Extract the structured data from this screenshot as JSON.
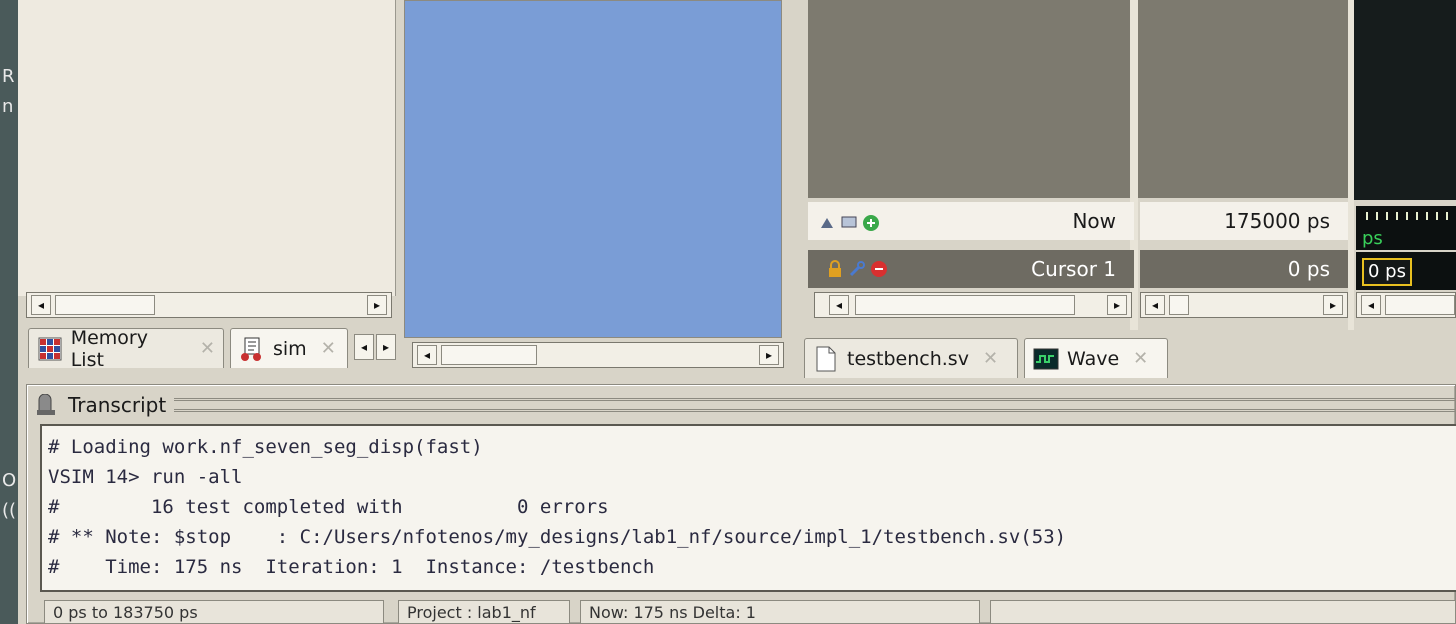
{
  "left_edge": {
    "chars": [
      "R",
      "n",
      "O",
      "(("
    ]
  },
  "tabs_left": [
    {
      "label": "Memory List",
      "close": "✕"
    },
    {
      "label": "sim",
      "close": "✕"
    }
  ],
  "tabs_right": [
    {
      "label": "testbench.sv",
      "close": "✕"
    },
    {
      "label": "Wave",
      "close": "✕"
    }
  ],
  "wave": {
    "now_label": "Now",
    "now_value": "175000 ps",
    "cursor_label": "Cursor 1",
    "cursor_value": "0 ps",
    "ruler_unit": "ps",
    "cursor_box": "0 ps"
  },
  "transcript": {
    "title": "Transcript",
    "lines": [
      "# Loading work.nf_seven_seg_disp(fast)",
      "VSIM 14> run -all",
      "#        16 test completed with          0 errors",
      "# ** Note: $stop    : C:/Users/nfotenos/my_designs/lab1_nf/source/impl_1/testbench.sv(53)",
      "#    Time: 175 ns  Iteration: 1  Instance: /testbench"
    ]
  },
  "statusbar": {
    "fields": [
      "0 ps to 183750 ps",
      "Project : lab1_nf",
      "Now: 175 ns  Delta: 1",
      ""
    ]
  },
  "icons": {
    "memory_list": "memory-grid-icon",
    "sim": "sim-hierarchy-icon",
    "testbench": "document-icon",
    "wave": "wave-window-icon",
    "transcript": "transcript-icon"
  },
  "colors": {
    "wave_bg": "#161c1c",
    "cursor_box_border": "#e8c020",
    "ruler_text": "#39d05a",
    "blue_pane": "#7a9dd6"
  }
}
